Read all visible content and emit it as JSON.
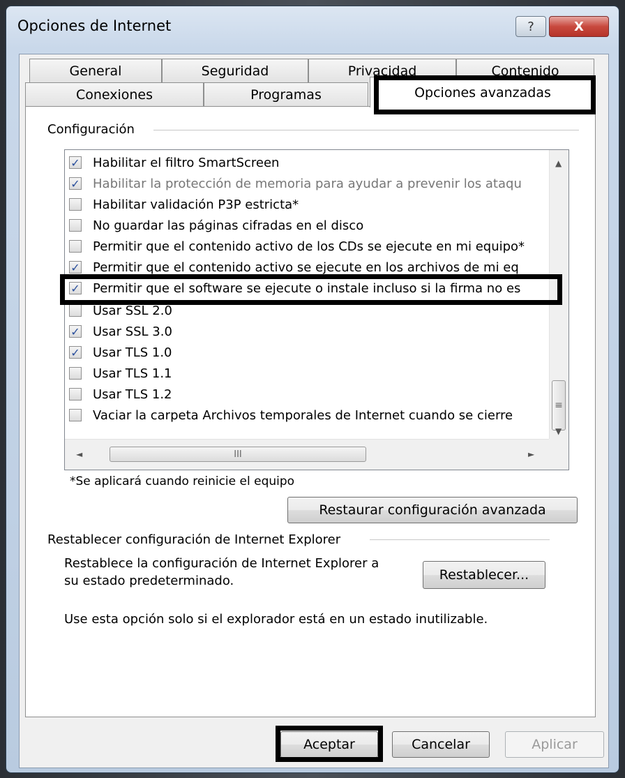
{
  "window": {
    "title": "Opciones de Internet",
    "help_glyph": "?",
    "close_glyph": "X"
  },
  "tabs": {
    "row1": [
      "General",
      "Seguridad",
      "Privacidad",
      "Contenido"
    ],
    "row2": [
      "Conexiones",
      "Programas",
      "Opciones avanzadas"
    ],
    "active": "Opciones avanzadas"
  },
  "settings": {
    "group_label": "Configuración",
    "items": [
      {
        "label": "Habilitar el filtro SmartScreen",
        "checked": true,
        "check": "✓"
      },
      {
        "label": "Habilitar la protección de memoria para ayudar a prevenir los ataqu",
        "checked": true,
        "check": "✓"
      },
      {
        "label": "Habilitar validación P3P estricta*",
        "checked": false,
        "check": ""
      },
      {
        "label": "No guardar las páginas cifradas en el disco",
        "checked": false,
        "check": ""
      },
      {
        "label": "Permitir que el contenido activo de los CDs se ejecute en mi equipo*",
        "checked": false,
        "check": ""
      },
      {
        "label": "Permitir que el contenido activo se ejecute en los archivos de mi eq",
        "checked": true,
        "check": "✓"
      },
      {
        "label": "Permitir que el software se ejecute o instale incluso si la firma no es",
        "checked": true,
        "check": "✓"
      },
      {
        "label": "Usar SSL 2.0",
        "checked": false,
        "check": ""
      },
      {
        "label": "Usar SSL 3.0",
        "checked": true,
        "check": "✓"
      },
      {
        "label": "Usar TLS 1.0",
        "checked": true,
        "check": "✓"
      },
      {
        "label": "Usar TLS 1.1",
        "checked": false,
        "check": ""
      },
      {
        "label": "Usar TLS 1.2",
        "checked": false,
        "check": ""
      },
      {
        "label": "Vaciar la carpeta Archivos temporales de Internet cuando se cierre",
        "checked": false,
        "check": ""
      }
    ],
    "scroll_up": "▲",
    "scroll_down": "▼",
    "scroll_left": "◄",
    "scroll_right": "►",
    "vgrip": "≡",
    "hgrip": "III",
    "restart_note": "*Se aplicará cuando reinicie el equipo",
    "restore_button": "Restaurar configuración avanzada"
  },
  "reset": {
    "group_label": "Restablecer configuración de Internet Explorer",
    "desc_line1": "Restablece la configuración de Internet Explorer a",
    "desc_line2": "su estado predeterminado.",
    "button": "Restablecer...",
    "note": "Use esta opción solo si el explorador está en un estado inutilizable."
  },
  "footer": {
    "ok": "Aceptar",
    "cancel": "Cancelar",
    "apply": "Aplicar"
  },
  "colors": {
    "highlight_border": "#000000",
    "check_color": "#2a4f9c"
  }
}
